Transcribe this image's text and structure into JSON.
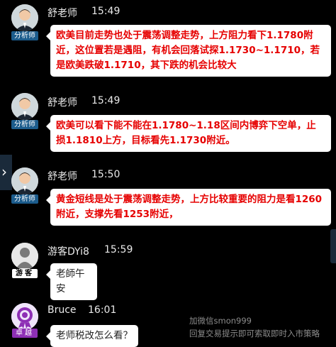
{
  "messages": [
    {
      "name": "舒老师",
      "time": "15:49",
      "tag": "分析师",
      "text": "欧美目前走势也处于震荡调整走势，上方阻力看下1.1780附近，这位置若是遇阻，有机会回落试探1.1730~1.1710，若是欧美跌破1.1710，其下跌的机会比较大",
      "style": "red"
    },
    {
      "name": "舒老师",
      "time": "15:49",
      "tag": "分析师",
      "text": "欧美可以看下能不能在1.1780~1.18区间内博弈下空单，止损1.1810上方，目标看先1.1730附近。",
      "style": "red"
    },
    {
      "name": "舒老师",
      "time": "15:50",
      "tag": "分析师",
      "text": "黄金短线是处于震荡调整走势，上方比较重要的阻力是看1260附近，支撑先看1253附近，",
      "style": "red"
    },
    {
      "name": "游客DYi8",
      "time": "15:59",
      "tag": "游客",
      "text": "老師午安",
      "style": "plain"
    },
    {
      "name": "Bruce",
      "time": "16:01",
      "tag": "卓越",
      "text": "老师税改怎么看？",
      "style": "plain"
    }
  ],
  "watermark": {
    "line1": "加微信smon999",
    "line2": "回复交易提示即可索取即时入市策略"
  },
  "icons": {
    "expand": "chevron-right-icon"
  },
  "colors": {
    "background": "#000000",
    "highlight_text": "#e60000",
    "analyst_tag": "#1c5c8c",
    "vip_tag": "#8e2fb5"
  }
}
